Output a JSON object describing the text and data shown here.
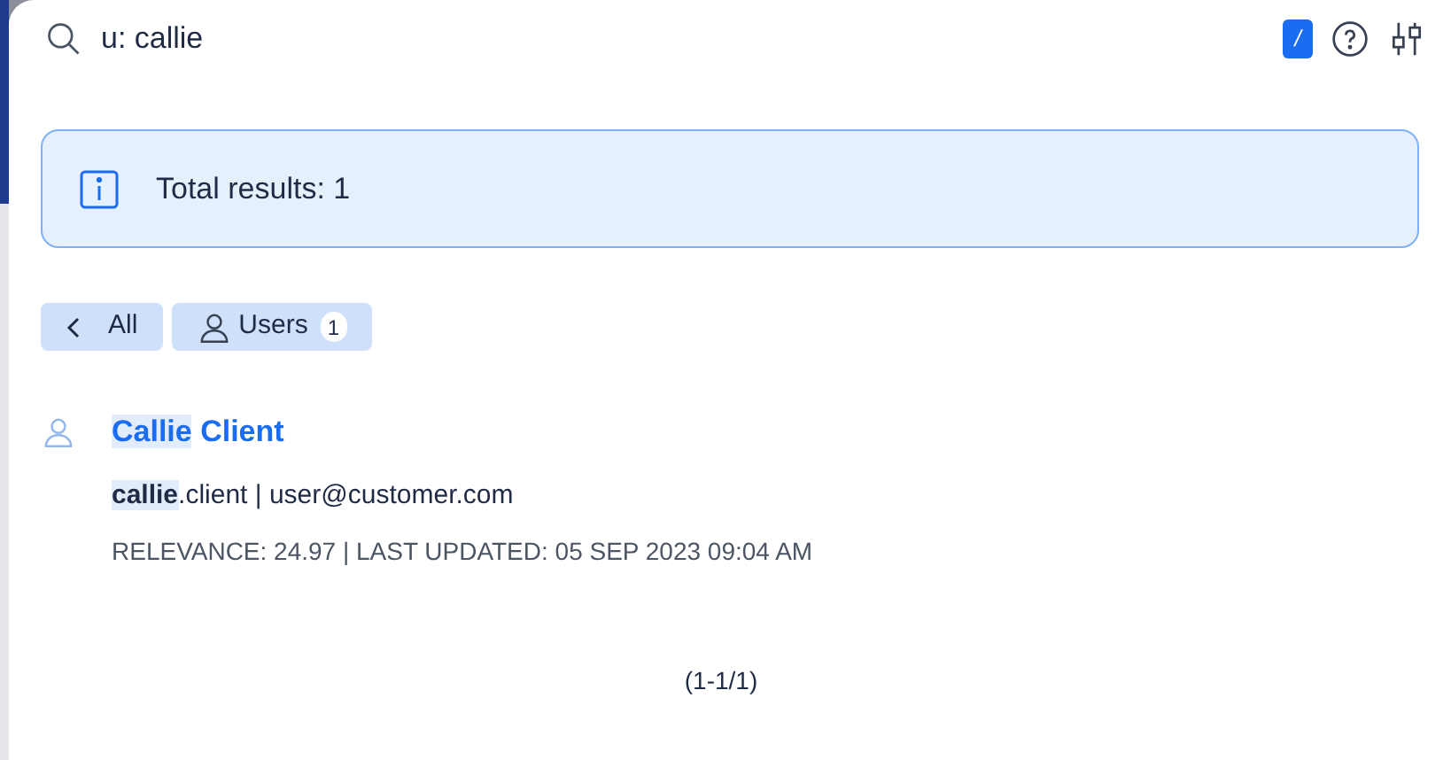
{
  "search": {
    "value": "u: callie",
    "shortcut_key": "/"
  },
  "info": {
    "text": "Total results: 1"
  },
  "filters": [
    {
      "kind": "back",
      "label": "All"
    },
    {
      "kind": "users",
      "label": "Users",
      "count": "1"
    }
  ],
  "results": [
    {
      "title_match": "Callie",
      "title_rest": " Client",
      "login_match": "callie",
      "login_rest": ".client",
      "separator": "|",
      "email": "user@customer.com",
      "meta": "RELEVANCE: 24.97 | LAST UPDATED: 05 SEP 2023 09:04 AM"
    }
  ],
  "pagination": "(1-1/1)"
}
